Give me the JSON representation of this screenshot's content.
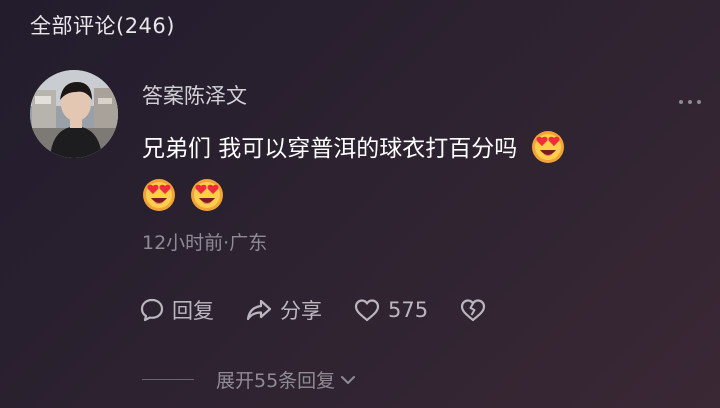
{
  "header": {
    "title": "全部评论(246)"
  },
  "comment": {
    "username": "答案陈泽文",
    "text": "兄弟们 我可以穿普洱的球衣打百分吗",
    "emojis": [
      "heart-eyes-emoji",
      "heart-eyes-emoji",
      "heart-eyes-emoji"
    ],
    "meta": "12小时前·广东"
  },
  "actions": {
    "reply_label": "回复",
    "share_label": "分享",
    "like_count": "575"
  },
  "replies": {
    "expand_label": "展开55条回复"
  },
  "colors": {
    "background_start": "#221c2c",
    "background_end": "#3a2834",
    "primary_text": "#ffffff",
    "secondary_text": "#8f8b95"
  }
}
